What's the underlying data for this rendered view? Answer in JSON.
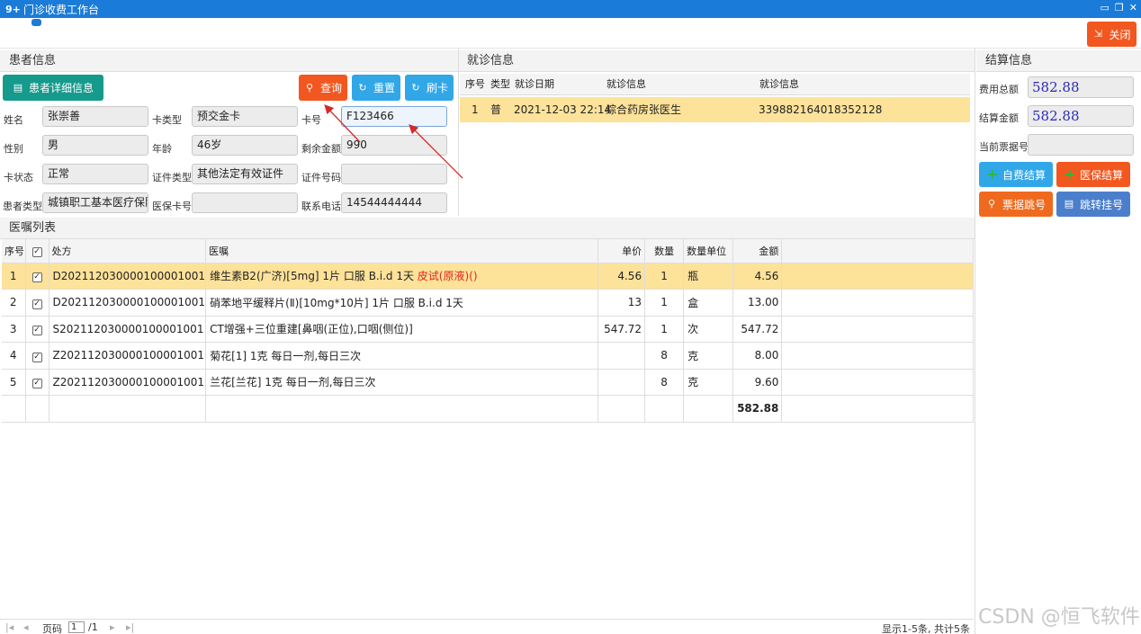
{
  "window": {
    "title": "门诊收费工作台",
    "close_button": "关闭"
  },
  "patient_panel": {
    "header": "患者信息",
    "detail_button": "患者详细信息",
    "query_button": "查询",
    "reset_button": "重置",
    "swipe_button": "刷卡",
    "labels": {
      "name": "姓名",
      "card_type": "卡类型",
      "card_no": "卡号",
      "gender": "性别",
      "age": "年龄",
      "balance": "剩余金额",
      "card_status": "卡状态",
      "id_type": "证件类型",
      "id_no": "证件号码",
      "patient_type": "患者类型",
      "insurance_card": "医保卡号",
      "phone": "联系电话"
    },
    "values": {
      "name": "张崇善",
      "card_type": "预交金卡",
      "card_no": "F123466",
      "gender": "男",
      "age": "46岁",
      "balance": "990",
      "card_status": "正常",
      "id_type": "其他法定有效证件",
      "id_no": "",
      "patient_type": "城镇职工基本医疗保险",
      "insurance_card": "",
      "phone": "14544444444"
    }
  },
  "visit_panel": {
    "header": "就诊信息",
    "columns": [
      "序号",
      "类型",
      "就诊日期",
      "就诊信息",
      "就诊信息"
    ],
    "rows": [
      {
        "seq": "1",
        "type": "普",
        "date": "2021-12-03 22:14",
        "info": "综合药房张医生",
        "info2": "339882164018352128"
      }
    ]
  },
  "orders_panel": {
    "header": "医嘱列表",
    "columns": {
      "seq": "序号",
      "prescription": "处方",
      "order": "医嘱",
      "price": "单价",
      "qty": "数量",
      "unit": "数量单位",
      "amount": "金额"
    },
    "rows": [
      {
        "seq": "1",
        "prescription": "D202112030000100001001",
        "order": "维生素B2(广济)[5mg] 1片 口服 B.i.d 1天 ",
        "order_extra": "皮试(原液)()",
        "price": "4.56",
        "qty": "1",
        "unit": "瓶",
        "amount": "4.56"
      },
      {
        "seq": "2",
        "prescription": "D202112030000100001001",
        "order": "硝苯地平缓释片(Ⅱ)[10mg*10片] 1片 口服 B.i.d 1天",
        "order_extra": "",
        "price": "13",
        "qty": "1",
        "unit": "盒",
        "amount": "13.00"
      },
      {
        "seq": "3",
        "prescription": "S202112030000100001001",
        "order": "CT增强+三位重建[鼻咽(正位),口咽(侧位)]",
        "order_extra": "",
        "price": "547.72",
        "qty": "1",
        "unit": "次",
        "amount": "547.72"
      },
      {
        "seq": "4",
        "prescription": "Z202112030000100001001",
        "order": "菊花[1] 1克 每日一剂,每日三次",
        "order_extra": "",
        "price": "",
        "qty": "8",
        "unit": "克",
        "amount": "8.00"
      },
      {
        "seq": "5",
        "prescription": "Z202112030000100001001",
        "order": "兰花[兰花] 1克 每日一剂,每日三次",
        "order_extra": "",
        "price": "",
        "qty": "8",
        "unit": "克",
        "amount": "9.60"
      }
    ],
    "total": "582.88"
  },
  "settlement_panel": {
    "header": "结算信息",
    "total_label": "费用总额",
    "total_value": "582.88",
    "settle_label": "结算金额",
    "settle_value": "582.88",
    "receipt_label": "当前票据号",
    "receipt_value": "",
    "self_pay_button": "自费结算",
    "insurance_button": "医保结算",
    "receipt_skip_button": "票据跳号",
    "register_skip_button": "跳转挂号"
  },
  "pager": {
    "page_label": "页码",
    "page_value": "1",
    "page_total": "/1",
    "summary": "显示1-5条, 共计5条"
  },
  "watermark": "CSDN @恒飞软件",
  "colors": {
    "accent_blue": "#1a7cd8",
    "orange": "#f2571f",
    "selected_row": "#fde29a",
    "link_red": "#e0241b"
  }
}
